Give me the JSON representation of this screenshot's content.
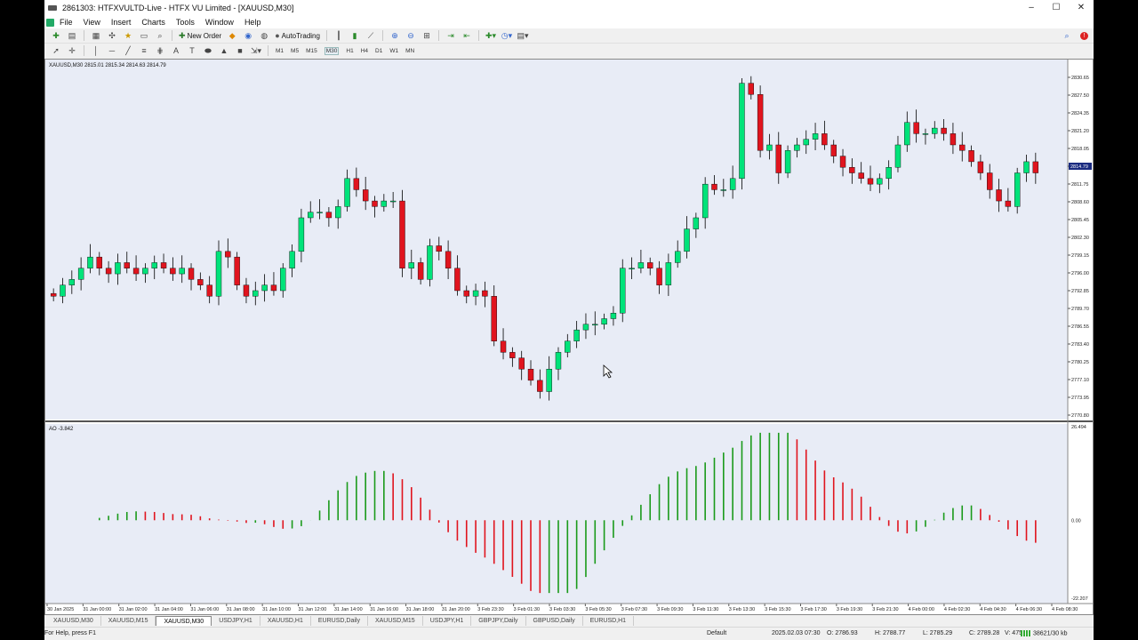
{
  "window": {
    "title": "2861303: HTFXVULTD-Live - HTFX VU Limited - [XAUUSD,M30]",
    "controls": [
      "–",
      "☐",
      "✕"
    ]
  },
  "menu": [
    "File",
    "View",
    "Insert",
    "Charts",
    "Tools",
    "Window",
    "Help"
  ],
  "toolbar": {
    "new_order": "New Order",
    "auto_trading": "AutoTrading",
    "timeframes": [
      "M1",
      "M5",
      "M15",
      "M30",
      "H1",
      "H4",
      "D1",
      "W1",
      "MN"
    ],
    "active_timeframe": "M30"
  },
  "chart": {
    "header": "XAUUSD,M30  2815.01 2815.34 2814.63 2814.79",
    "price_axis": [
      "2830.65",
      "2827.50",
      "2824.35",
      "2821.20",
      "2818.05",
      "2814.79",
      "2811.75",
      "2808.60",
      "2805.45",
      "2802.30",
      "2799.15",
      "2796.00",
      "2792.85",
      "2789.70",
      "2786.55",
      "2783.40",
      "2780.25",
      "2777.10",
      "2773.95",
      "2770.80"
    ],
    "current_price": "2814.79",
    "time_axis": [
      "30 Jan 2025",
      "31 Jan 00:00",
      "31 Jan 02:00",
      "31 Jan 04:00",
      "31 Jan 06:00",
      "31 Jan 08:00",
      "31 Jan 10:00",
      "31 Jan 12:00",
      "31 Jan 14:00",
      "31 Jan 16:00",
      "31 Jan 18:00",
      "31 Jan 20:00",
      "3 Feb 23:30",
      "3 Feb 01:30",
      "3 Feb 03:30",
      "3 Feb 05:30",
      "3 Feb 07:30",
      "3 Feb 09:30",
      "3 Feb 11:30",
      "3 Feb 13:30",
      "3 Feb 15:30",
      "3 Feb 17:30",
      "3 Feb 19:30",
      "3 Feb 21:30",
      "4 Feb 00:00",
      "4 Feb 02:30",
      "4 Feb 04:30",
      "4 Feb 06:30",
      "4 Feb 08:30"
    ],
    "indicator_label": "AO -3.842",
    "indicator_axis": [
      "26.494",
      "0.00",
      "-22.207"
    ],
    "colors": {
      "bull": "#00e37a",
      "bear": "#e0141e",
      "ao_up": "#1a9a1a",
      "ao_down": "#e0141e",
      "background": "#e8ecf6",
      "current_price_bg": "#1a2b80"
    }
  },
  "chart_data": {
    "type": "candlestick",
    "symbol": "XAUUSD",
    "timeframe": "M30",
    "ylim": [
      2770.8,
      2832.0
    ],
    "candles_approx_close": [
      2792,
      2794,
      2795,
      2797,
      2799,
      2797,
      2796,
      2798,
      2797,
      2796,
      2797,
      2798,
      2797,
      2796,
      2797,
      2795,
      2794,
      2792,
      2800,
      2799,
      2794,
      2792,
      2793,
      2794,
      2793,
      2797,
      2800,
      2806,
      2807,
      2807,
      2806,
      2808,
      2813,
      2811,
      2809,
      2808,
      2809,
      2809,
      2797,
      2798,
      2795,
      2801,
      2800,
      2797,
      2793,
      2792,
      2793,
      2792,
      2784,
      2782,
      2781,
      2779,
      2777,
      2775,
      2779,
      2782,
      2784,
      2786,
      2787,
      2787,
      2788,
      2789,
      2797,
      2797,
      2798,
      2797,
      2794,
      2798,
      2800,
      2804,
      2806,
      2812,
      2811,
      2811,
      2813,
      2830,
      2828,
      2818,
      2819,
      2814,
      2818,
      2819,
      2820,
      2821,
      2819,
      2817,
      2815,
      2814,
      2813,
      2812,
      2813,
      2815,
      2819,
      2823,
      2821,
      2821,
      2822,
      2821,
      2819,
      2818,
      2816,
      2814,
      2811,
      2809,
      2808,
      2814,
      2816,
      2814
    ],
    "indicator": {
      "name": "Awesome Oscillator",
      "value": -3.842,
      "ylim": [
        -22.207,
        26.494
      ]
    }
  },
  "tabs": [
    "XAUUSD,M30",
    "XAUUSD,M15",
    "XAUUSD,M30",
    "USDJPY,H1",
    "XAUUSD,H1",
    "EURUSD,Daily",
    "XAUUSD,M15",
    "USDJPY,H1",
    "GBPJPY,Daily",
    "GBPUSD,Daily",
    "EURUSD,H1"
  ],
  "active_tab": 2,
  "status": {
    "help": "For Help, press F1",
    "profile": "Default",
    "datetime": "2025.02.03 07:30",
    "open": "O: 2786.93",
    "high": "H: 2788.77",
    "low": "L: 2785.29",
    "close": "C: 2789.28",
    "volume": "V: 4756",
    "traffic": "38621/30 kb"
  }
}
